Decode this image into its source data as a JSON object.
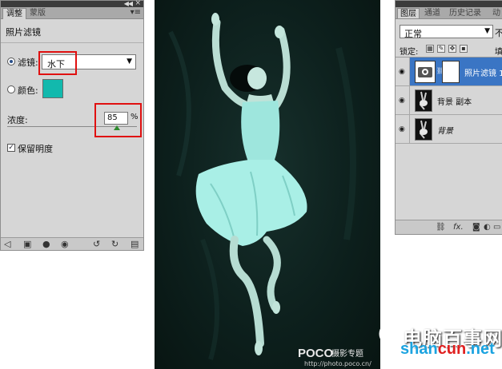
{
  "adjustments_panel": {
    "tabs": [
      "调整",
      "蒙版"
    ],
    "title": "照片滤镜",
    "filter_label": "滤镜:",
    "filter_value": "水下",
    "color_label": "颜色:",
    "color_hex": "#12b9ad",
    "density_label": "浓度:",
    "density_value": "85",
    "density_unit": "%",
    "density_fraction": 0.85,
    "preserve_label": "保留明度",
    "preserve_checked": true,
    "icons": [
      "back-arrow-icon",
      "view-icon",
      "clip-icon",
      "visibility-icon",
      "previous-state-icon",
      "reset-icon",
      "trash-icon"
    ]
  },
  "layers_panel": {
    "tabs": [
      "图层",
      "通道",
      "历史记录",
      "动"
    ],
    "blend_mode": "正常",
    "opacity_label_cut": "不",
    "lock_label": "锁定:",
    "fill_label_cut": "填",
    "layers": [
      {
        "name": "照片滤镜 1",
        "selected": true,
        "type": "adjustment"
      },
      {
        "name": "背景 副本",
        "selected": false,
        "type": "image"
      },
      {
        "name": "背景",
        "selected": false,
        "type": "image",
        "italic": true
      }
    ],
    "footer_icons": [
      "link-icon",
      "fx-icon",
      "mask-icon",
      "adjustment-icon",
      "folder-icon",
      "new-layer-icon",
      "trash-icon"
    ]
  },
  "photo": {
    "watermark_brand": "POCO",
    "watermark_sub": "摄影专题",
    "watermark_url": "http://photo.poco.cn/"
  },
  "site_watermark": {
    "name": "电脑百事网",
    "domain": "shancun.net",
    "domain_prefix": "shan",
    "domain_mid": "cun",
    "domain_suffix": ".net"
  }
}
